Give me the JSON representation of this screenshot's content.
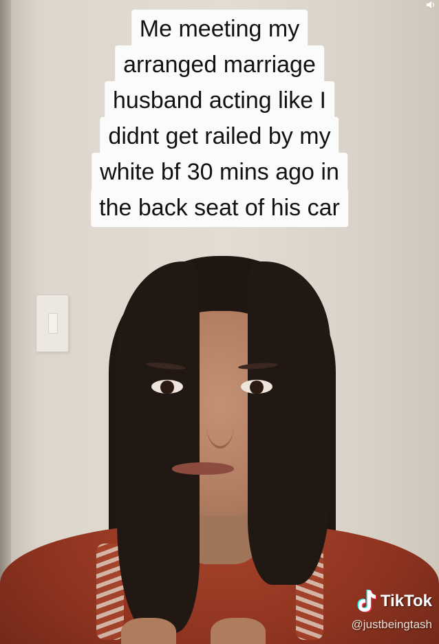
{
  "caption": {
    "lines": [
      "Me meeting my",
      "arranged marriage",
      "husband acting like I",
      "didnt get railed by my",
      "white bf 30 mins ago in",
      "the back seat of his car"
    ]
  },
  "watermark": {
    "brand": "TikTok",
    "handle": "@justbeingtash",
    "icon": "tiktok-logo-icon"
  },
  "colors": {
    "caption_bg": "#fbfbfb",
    "caption_text": "#111111",
    "shirt": "#8f3420",
    "hair": "#1f1612",
    "wall": "#e2dcd3"
  }
}
